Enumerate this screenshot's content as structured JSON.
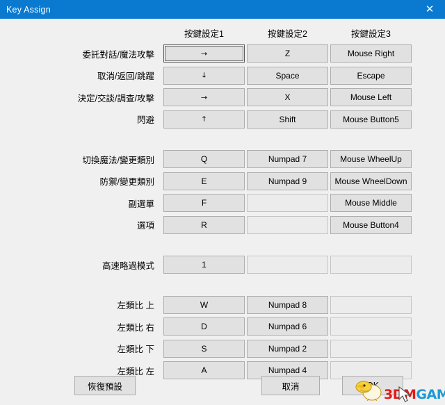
{
  "window": {
    "title": "Key Assign",
    "close_icon": "close-icon",
    "titlebar_color": "#0a7ad0"
  },
  "columns": [
    {
      "header": "按鍵設定1"
    },
    {
      "header": "按鍵設定2"
    },
    {
      "header": "按鍵設定3"
    }
  ],
  "groups": [
    {
      "rows": [
        {
          "label": "委託對話/魔法攻擊",
          "keys": [
            "→",
            "Z",
            "Mouse Right"
          ],
          "focused": 0
        },
        {
          "label": "取消/返回/跳躍",
          "keys": [
            "↓",
            "Space",
            "Escape"
          ]
        },
        {
          "label": "決定/交談/調查/攻擊",
          "keys": [
            "→",
            "X",
            "Mouse Left"
          ]
        },
        {
          "label": "閃避",
          "keys": [
            "↑",
            "Shift",
            "Mouse Button5"
          ]
        }
      ]
    },
    {
      "rows": [
        {
          "label": "切換魔法/變更類別",
          "keys": [
            "Q",
            "Numpad 7",
            "Mouse WheelUp"
          ]
        },
        {
          "label": "防禦/變更類別",
          "keys": [
            "E",
            "Numpad 9",
            "Mouse WheelDown"
          ]
        },
        {
          "label": "副選單",
          "keys": [
            "F",
            "",
            "Mouse Middle"
          ]
        },
        {
          "label": "選項",
          "keys": [
            "R",
            "",
            "Mouse Button4"
          ]
        }
      ]
    },
    {
      "rows": [
        {
          "label": "高速略過模式",
          "keys": [
            "1",
            "",
            ""
          ]
        }
      ]
    },
    {
      "rows": [
        {
          "label": "左類比 上",
          "keys": [
            "W",
            "Numpad 8",
            ""
          ]
        },
        {
          "label": "左類比 右",
          "keys": [
            "D",
            "Numpad 6",
            ""
          ]
        },
        {
          "label": "左類比 下",
          "keys": [
            "S",
            "Numpad 2",
            ""
          ]
        },
        {
          "label": "左類比 左",
          "keys": [
            "A",
            "Numpad 4",
            ""
          ]
        }
      ]
    }
  ],
  "footer": {
    "restore_label": "恢復預設",
    "cancel_label": "取消",
    "ok_label": "OK"
  },
  "watermark": {
    "text_primary": "3DM",
    "text_secondary": "GAME",
    "color_primary": "#e01b18",
    "color_secondary": "#1b9ad6",
    "mascot_icon": "chick-mascot-icon"
  }
}
